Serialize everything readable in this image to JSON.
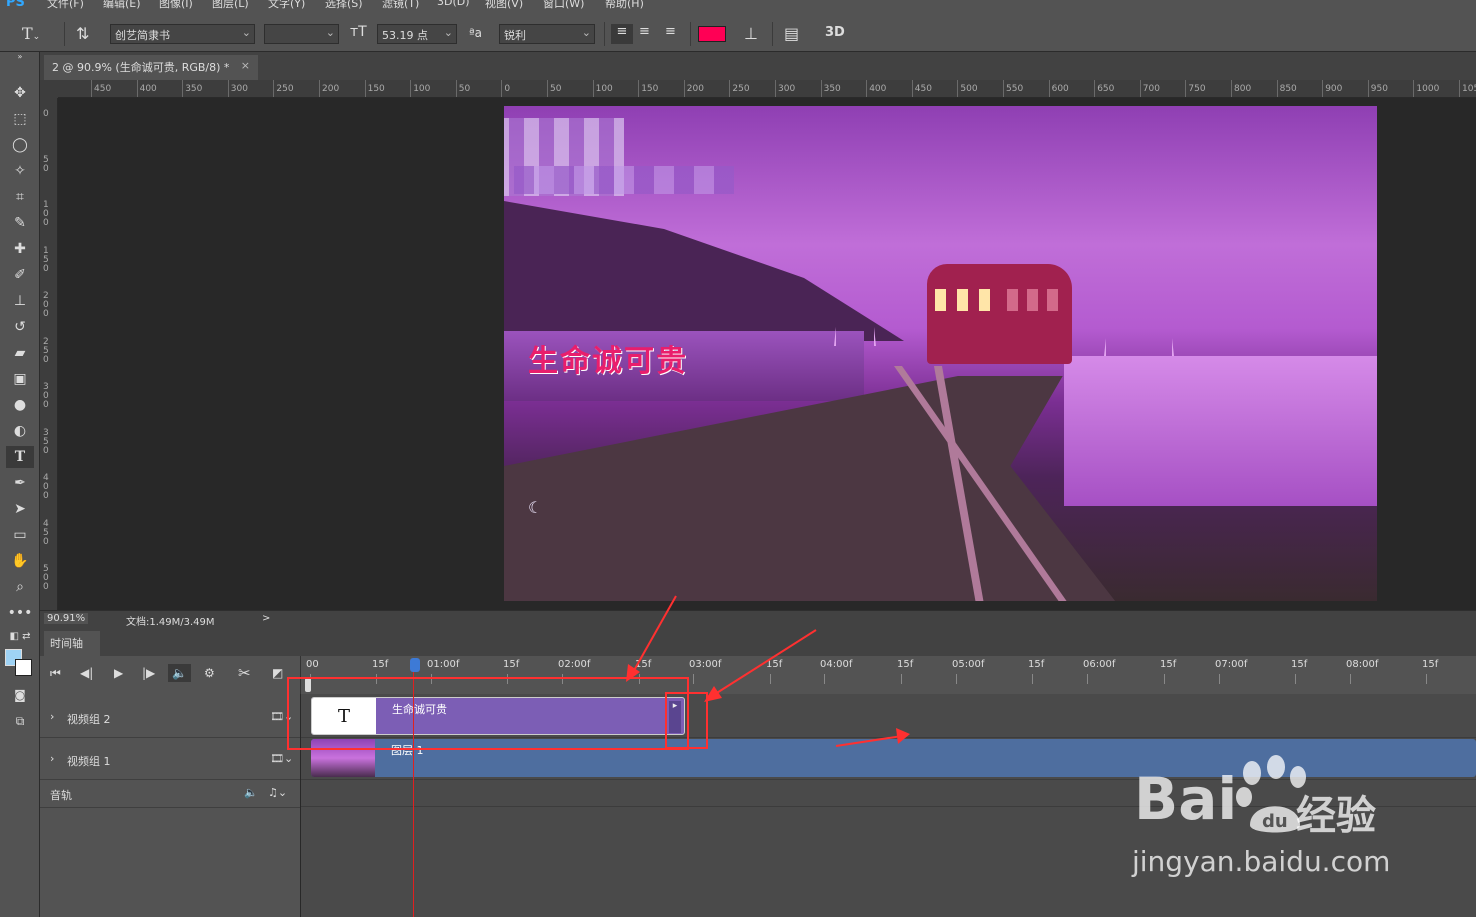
{
  "app": {
    "logo": "PS"
  },
  "menu": [
    "文件(F)",
    "编辑(E)",
    "图像(I)",
    "图层(L)",
    "文字(Y)",
    "选择(S)",
    "滤镜(T)",
    "3D(D)",
    "视图(V)",
    "窗口(W)",
    "帮助(H)"
  ],
  "options": {
    "font_family": "创艺简隶书",
    "font_style": "",
    "font_size": "53.19 点",
    "antialias_icon": "ªa",
    "antialias": "锐利",
    "text_color": "#ff0055",
    "btn_3d": "3D"
  },
  "document": {
    "tab_title": "2 @ 90.9% (生命诚可贵, RGB/8) *",
    "close": "×"
  },
  "rulers": {
    "h_labels": [
      "450",
      "400",
      "350",
      "300",
      "250",
      "200",
      "150",
      "100",
      "50",
      "0",
      "50",
      "100",
      "150",
      "200",
      "250",
      "300",
      "350",
      "400",
      "450",
      "500",
      "550",
      "600",
      "650",
      "700",
      "750",
      "800",
      "850",
      "900",
      "950",
      "1000",
      "105"
    ],
    "v_labels": [
      "0",
      "50",
      "100",
      "150",
      "200",
      "250",
      "300",
      "350",
      "400",
      "450",
      "500"
    ]
  },
  "canvas": {
    "overlay_text": "生命诚可贵"
  },
  "status": {
    "zoom": "90.91%",
    "doc": "文档:1.49M/3.49M",
    "arrow": ">"
  },
  "timeline": {
    "tab_label": "时间轴",
    "ruler_labels": [
      "00",
      "15f",
      "01:00f",
      "15f",
      "02:00f",
      "15f",
      "03:00f",
      "15f",
      "04:00f",
      "15f",
      "05:00f",
      "15f",
      "06:00f",
      "15f",
      "07:00f",
      "15f",
      "08:00f",
      "15f"
    ],
    "tracks": [
      {
        "label": "视频组 2"
      },
      {
        "label": "视频组 1"
      },
      {
        "label": "音轨"
      }
    ],
    "clips": {
      "text_clip_label": "生命诚可贵",
      "text_clip_thumb": "T",
      "layer_clip_label": "图层 1"
    }
  },
  "watermark": {
    "brand": "Bai",
    "suffix": "经验",
    "url": "jingyan.baidu.com"
  }
}
